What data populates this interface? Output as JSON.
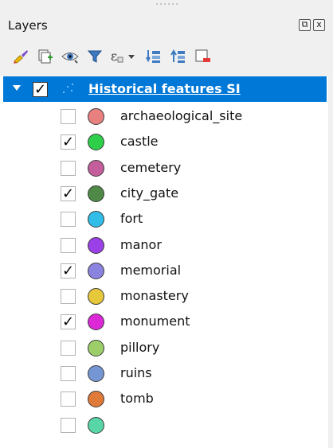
{
  "panel": {
    "title": "Layers",
    "float_btn_glyph": "⧉",
    "close_btn_glyph": "x"
  },
  "toolbar": [
    {
      "name": "style-manager-icon"
    },
    {
      "name": "add-group-icon"
    },
    {
      "name": "manage-visibility-icon"
    },
    {
      "name": "filter-legend-icon"
    },
    {
      "name": "filter-expression-icon"
    },
    {
      "name": "expand-all-icon"
    },
    {
      "name": "collapse-all-icon"
    },
    {
      "name": "remove-layer-icon"
    }
  ],
  "layer": {
    "name": "Historical features SI",
    "checked": true,
    "expanded": true
  },
  "legend_items": [
    {
      "label": "archaeological_site",
      "checked": false,
      "color": "#e88080"
    },
    {
      "label": "castle",
      "checked": true,
      "color": "#2ed04a"
    },
    {
      "label": "cemetery",
      "checked": false,
      "color": "#c45e9c"
    },
    {
      "label": "city_gate",
      "checked": true,
      "color": "#4e8a46"
    },
    {
      "label": "fort",
      "checked": false,
      "color": "#30bde8"
    },
    {
      "label": "manor",
      "checked": false,
      "color": "#9b3fe6"
    },
    {
      "label": "memorial",
      "checked": true,
      "color": "#8a83e0"
    },
    {
      "label": "monastery",
      "checked": false,
      "color": "#e6c83a"
    },
    {
      "label": "monument",
      "checked": true,
      "color": "#dd28d8"
    },
    {
      "label": "pillory",
      "checked": false,
      "color": "#9cce6a"
    },
    {
      "label": "ruins",
      "checked": false,
      "color": "#7497d4"
    },
    {
      "label": "tomb",
      "checked": false,
      "color": "#e07a38"
    },
    {
      "label": "",
      "checked": false,
      "color": "#58d6a8"
    }
  ]
}
